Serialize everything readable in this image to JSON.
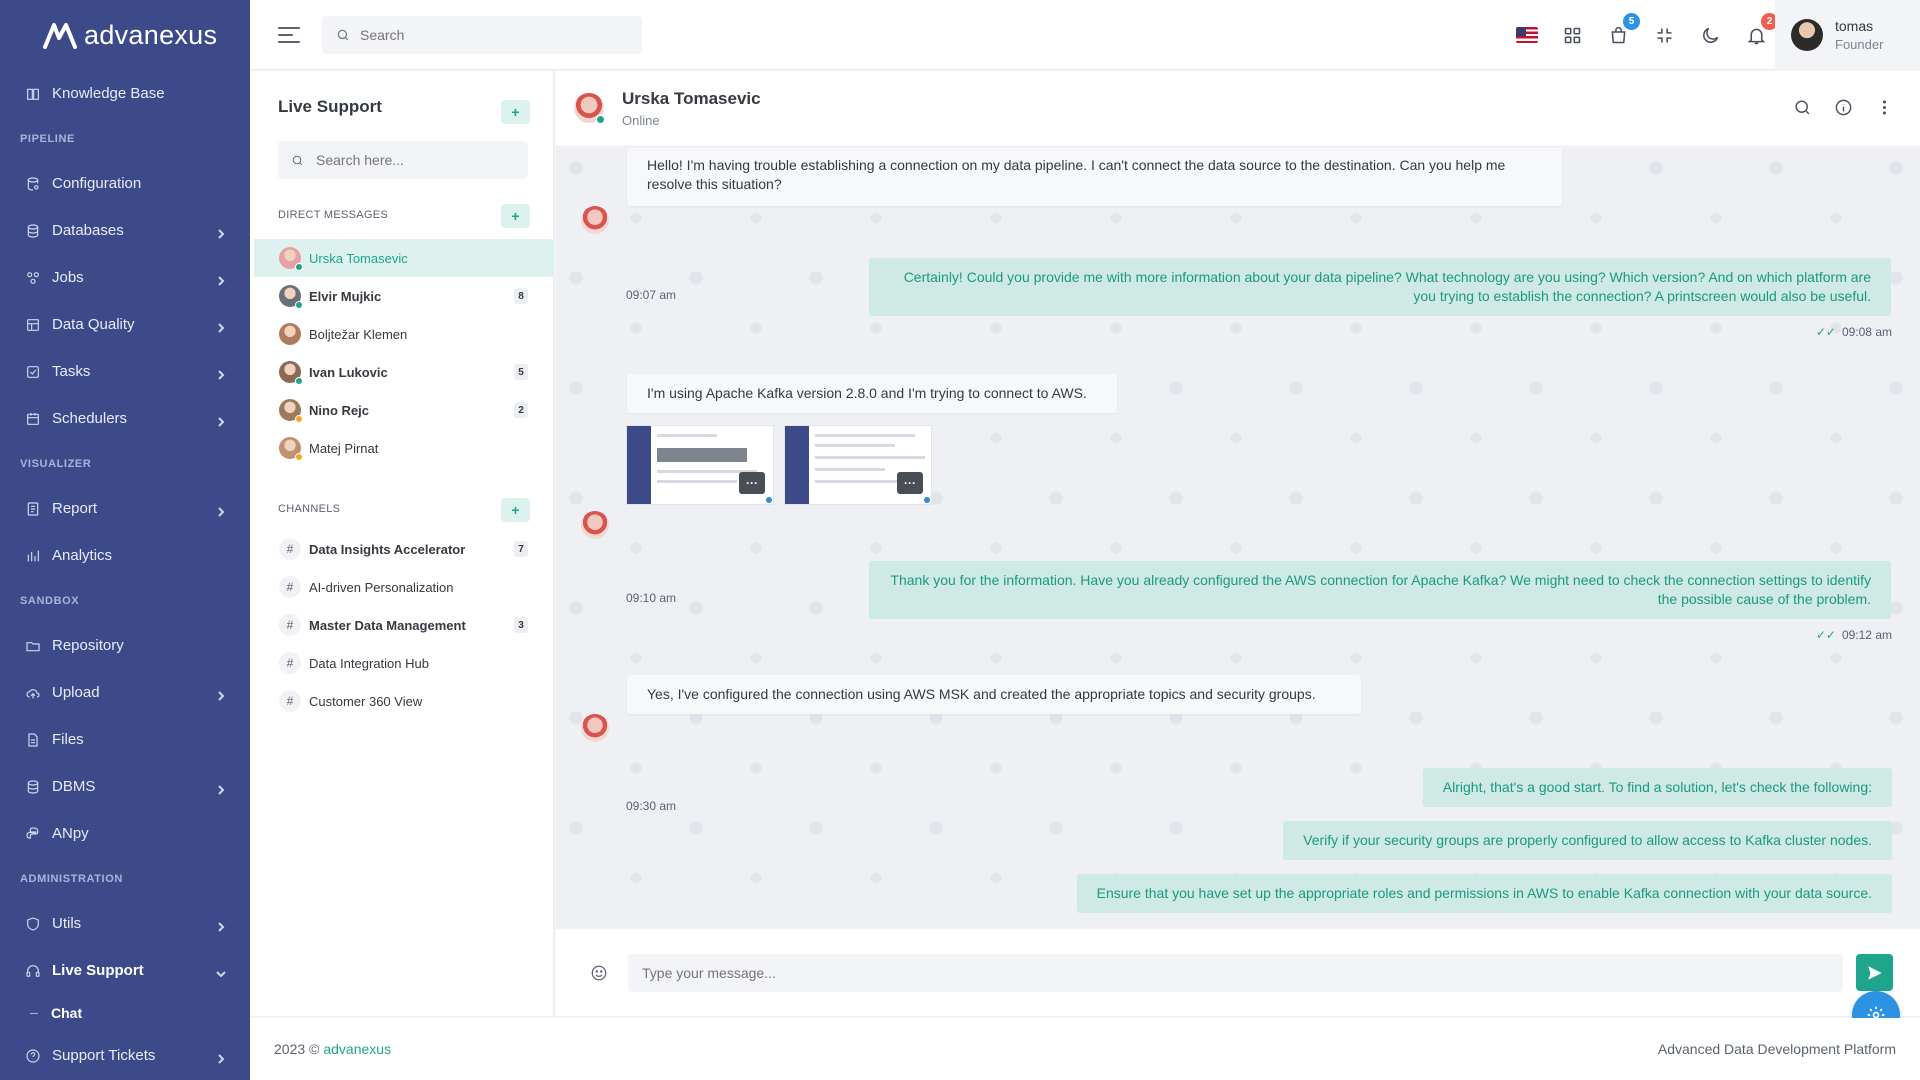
{
  "app": {
    "name": "advanexus"
  },
  "sidebar": {
    "items": [
      {
        "type": "item",
        "label": "Knowledge Base",
        "icon": "book-icon",
        "chevron": false
      },
      {
        "type": "section",
        "label": "PIPELINE"
      },
      {
        "type": "item",
        "label": "Configuration",
        "icon": "database-cog-icon",
        "chevron": false
      },
      {
        "type": "item",
        "label": "Databases",
        "icon": "database-icon",
        "chevron": true
      },
      {
        "type": "item",
        "label": "Jobs",
        "icon": "jobs-icon",
        "chevron": true
      },
      {
        "type": "item",
        "label": "Data Quality",
        "icon": "table-icon",
        "chevron": true
      },
      {
        "type": "item",
        "label": "Tasks",
        "icon": "checkbox-icon",
        "chevron": true
      },
      {
        "type": "item",
        "label": "Schedulers",
        "icon": "calendar-icon",
        "chevron": true
      },
      {
        "type": "section",
        "label": "VISUALIZER"
      },
      {
        "type": "item",
        "label": "Report",
        "icon": "report-icon",
        "chevron": true
      },
      {
        "type": "item",
        "label": "Analytics",
        "icon": "bar-chart-icon",
        "chevron": false
      },
      {
        "type": "section",
        "label": "SANDBOX"
      },
      {
        "type": "item",
        "label": "Repository",
        "icon": "folder-icon",
        "chevron": false
      },
      {
        "type": "item",
        "label": "Upload",
        "icon": "cloud-upload-icon",
        "chevron": true
      },
      {
        "type": "item",
        "label": "Files",
        "icon": "file-icon",
        "chevron": false
      },
      {
        "type": "item",
        "label": "DBMS",
        "icon": "database-icon",
        "chevron": true
      },
      {
        "type": "item",
        "label": "ANpy",
        "icon": "python-icon",
        "chevron": false
      },
      {
        "type": "section",
        "label": "ADMINISTRATION"
      },
      {
        "type": "item",
        "label": "Utils",
        "icon": "shield-icon",
        "chevron": true
      },
      {
        "type": "item",
        "label": "Live Support",
        "icon": "headset-icon",
        "chevron": "down",
        "active": true
      },
      {
        "type": "sub",
        "label": "Chat"
      },
      {
        "type": "item",
        "label": "Support Tickets",
        "icon": "help-circle-icon",
        "chevron": true
      }
    ]
  },
  "topbar": {
    "search_placeholder": "Search",
    "cart_badge": "5",
    "notif_badge": "2",
    "user": {
      "name": "tomas",
      "role": "Founder"
    }
  },
  "chat_list": {
    "title": "Live Support",
    "search_placeholder": "Search here...",
    "dm_title": "DIRECT MESSAGES",
    "channels_title": "CHANNELS",
    "dms": [
      {
        "name": "Urska Tomasevic",
        "count": "",
        "active": true,
        "status": "#1fa58b",
        "av": "#e7a0a5"
      },
      {
        "name": "Elvir Mujkic",
        "count": "8",
        "bold": true,
        "status": "#1fa58b",
        "av": "#6b7078"
      },
      {
        "name": "Boljtežar Klemen",
        "count": "",
        "status": "",
        "av": "#b07a5e"
      },
      {
        "name": "Ivan Lukovic",
        "count": "5",
        "bold": true,
        "status": "#1fa58b",
        "av": "#8a6a55"
      },
      {
        "name": "Nino Rejc",
        "count": "2",
        "bold": true,
        "status": "#f5a623",
        "av": "#9b7b5c"
      },
      {
        "name": "Matej Pirnat",
        "count": "",
        "status": "#f5a623",
        "av": "#c09070"
      }
    ],
    "channels": [
      {
        "name": "Data Insights Accelerator",
        "count": "7",
        "bold": true
      },
      {
        "name": "AI-driven Personalization",
        "count": ""
      },
      {
        "name": "Master Data Management",
        "count": "3",
        "bold": true
      },
      {
        "name": "Data Integration Hub",
        "count": ""
      },
      {
        "name": "Customer 360 View",
        "count": ""
      }
    ]
  },
  "conversation": {
    "name": "Urska Tomasevic",
    "status": "Online",
    "messages": [
      {
        "text": "Hello! I'm having trouble establishing a connection on my data pipeline. I can't connect the data source to the destination. Can you help me resolve this situation?"
      },
      {
        "time": "09:07 am"
      },
      {
        "text": "Certainly! Could you provide me with more information about your data pipeline? What technology are you using? Which version? And on which platform are you trying to establish the connection? A printscreen would also be useful."
      },
      {
        "time": "09:08 am"
      },
      {
        "text": "I'm using Apache Kafka version 2.8.0 and I'm trying to connect to AWS."
      },
      {
        "time": "09:10 am"
      },
      {
        "text": "Thank you for the information. Have you already configured the AWS connection for Apache Kafka? We might need to check the connection settings to identify the possible cause of the problem."
      },
      {
        "time": "09:12 am"
      },
      {
        "text": "Yes, I've configured the connection using AWS MSK and created the appropriate topics and security groups."
      },
      {
        "time": "09:30 am"
      },
      {
        "text": "Alright, that's a good start. To find a solution, let's check the following:"
      },
      {
        "text": "Verify if your security groups are properly configured to allow access to Kafka cluster nodes."
      },
      {
        "text": "Ensure that you have set up the appropriate roles and permissions in AWS to enable Kafka connection with your data source."
      }
    ],
    "input_placeholder": "Type your message..."
  },
  "footer": {
    "copyright": "2023 ©",
    "brand": "advanexus",
    "right": "Advanced Data Development Platform"
  },
  "colors": {
    "sidebar": "#3c4a8a",
    "accent": "#1fa58b",
    "fab": "#2b92e4"
  }
}
